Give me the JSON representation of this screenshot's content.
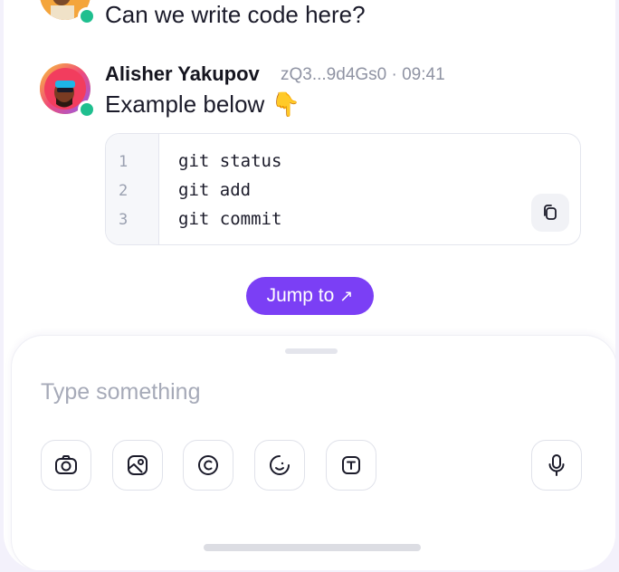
{
  "messages": [
    {
      "text": "Can we write code here?"
    },
    {
      "author": "Alisher Yakupov",
      "meta": "zQ3...9d4Gs0 · 09:41",
      "text": "Example below",
      "emoji": "👇"
    }
  ],
  "code_block": {
    "lines": [
      {
        "num": "1",
        "code": "git status"
      },
      {
        "num": "2",
        "code": "git add"
      },
      {
        "num": "3",
        "code": "git commit"
      }
    ],
    "copy_icon": "copy-icon"
  },
  "jump": {
    "label": "Jump to",
    "arrow": "↗"
  },
  "composer": {
    "placeholder": "Type something",
    "tools": [
      "camera-icon",
      "image-icon",
      "copyright-icon",
      "sticker-icon",
      "text-format-icon"
    ],
    "mic_icon": "microphone-icon"
  },
  "colors": {
    "accent": "#7b3ff5",
    "online": "#1fbf8f"
  }
}
